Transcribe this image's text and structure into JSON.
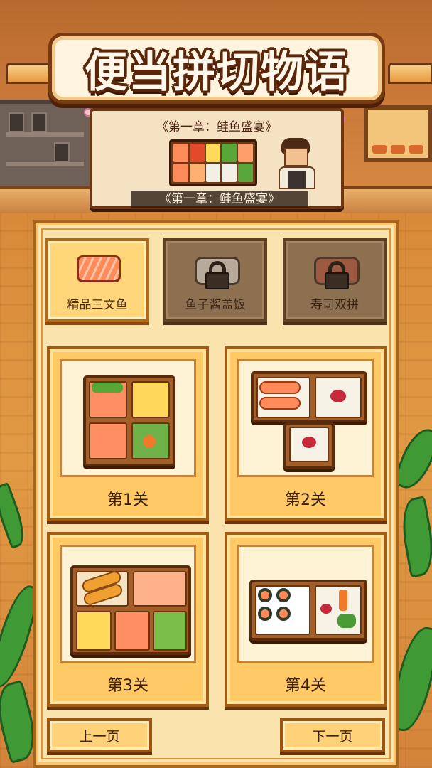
{
  "game": {
    "title": "便当拼切物语"
  },
  "chapter": {
    "title_top": "《第一章：鲑鱼盛宴》",
    "title_bottom": "《第一章：鲑鱼盛宴》"
  },
  "categories": [
    {
      "label": "精品三文鱼",
      "state": "unlocked",
      "icon": "salmon-icon"
    },
    {
      "label": "鱼子酱盖饭",
      "state": "locked",
      "icon": "lock-icon"
    },
    {
      "label": "寿司双拼",
      "state": "locked",
      "icon": "lock-icon"
    }
  ],
  "levels": [
    {
      "label": "第1关",
      "icon": "bento-four-compartment-icon"
    },
    {
      "label": "第2关",
      "icon": "bento-t-shape-salmon-icon"
    },
    {
      "label": "第3关",
      "icon": "bento-tempura-sushi-icon"
    },
    {
      "label": "第4关",
      "icon": "bento-maki-vegetable-icon"
    }
  ],
  "navigation": {
    "prev_label": "上一页",
    "next_label": "下一页"
  },
  "colors": {
    "panel": "#fbe3ad",
    "card": "#ffc966",
    "wood_border": "#a45c14",
    "locked_tab": "#8c7050",
    "title_outline": "#5a260a"
  }
}
